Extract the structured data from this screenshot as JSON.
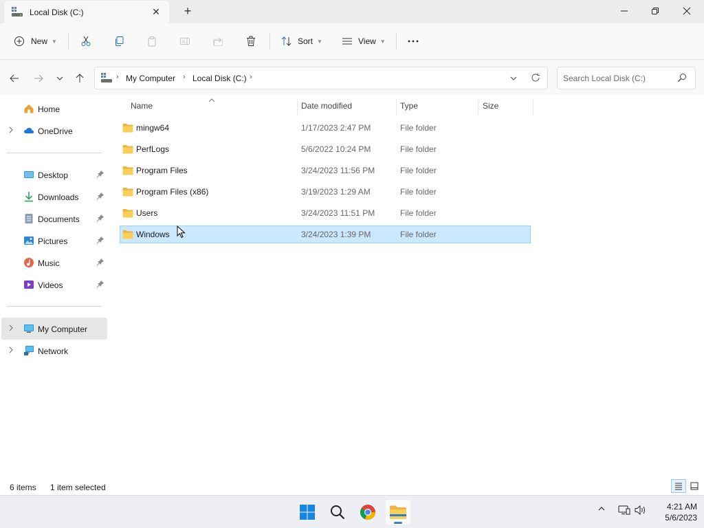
{
  "window": {
    "tab_title": "Local Disk (C:)"
  },
  "toolbar": {
    "new_label": "New",
    "sort_label": "Sort",
    "view_label": "View"
  },
  "address": {
    "crumbs": [
      "My Computer",
      "Local Disk (C:)"
    ]
  },
  "search": {
    "placeholder": "Search Local Disk (C:)"
  },
  "nav": {
    "home": "Home",
    "onedrive": "OneDrive",
    "quick_access": [
      {
        "label": "Desktop",
        "icon": "desktop-icon"
      },
      {
        "label": "Downloads",
        "icon": "downloads-icon"
      },
      {
        "label": "Documents",
        "icon": "documents-icon"
      },
      {
        "label": "Pictures",
        "icon": "pictures-icon"
      },
      {
        "label": "Music",
        "icon": "music-icon"
      },
      {
        "label": "Videos",
        "icon": "videos-icon"
      }
    ],
    "my_computer": "My Computer",
    "network": "Network"
  },
  "columns": {
    "name": "Name",
    "date": "Date modified",
    "type": "Type",
    "size": "Size"
  },
  "files": [
    {
      "name": "mingw64",
      "date": "1/17/2023 2:47 PM",
      "type": "File folder",
      "selected": false
    },
    {
      "name": "PerfLogs",
      "date": "5/6/2022 10:24 PM",
      "type": "File folder",
      "selected": false
    },
    {
      "name": "Program Files",
      "date": "3/24/2023 11:56 PM",
      "type": "File folder",
      "selected": false
    },
    {
      "name": "Program Files (x86)",
      "date": "3/19/2023 1:29 AM",
      "type": "File folder",
      "selected": false
    },
    {
      "name": "Users",
      "date": "3/24/2023 11:51 PM",
      "type": "File folder",
      "selected": false
    },
    {
      "name": "Windows",
      "date": "3/24/2023 1:39 PM",
      "type": "File folder",
      "selected": true
    }
  ],
  "status": {
    "item_count": "6 items",
    "selection": "1 item selected"
  },
  "clock": {
    "time": "4:21 AM",
    "date": "5/6/2023"
  },
  "colors": {
    "selection_bg": "#cce8ff",
    "selection_border": "#99d1ff",
    "folder": "#f8cf5a",
    "accent": "#0067c0"
  }
}
